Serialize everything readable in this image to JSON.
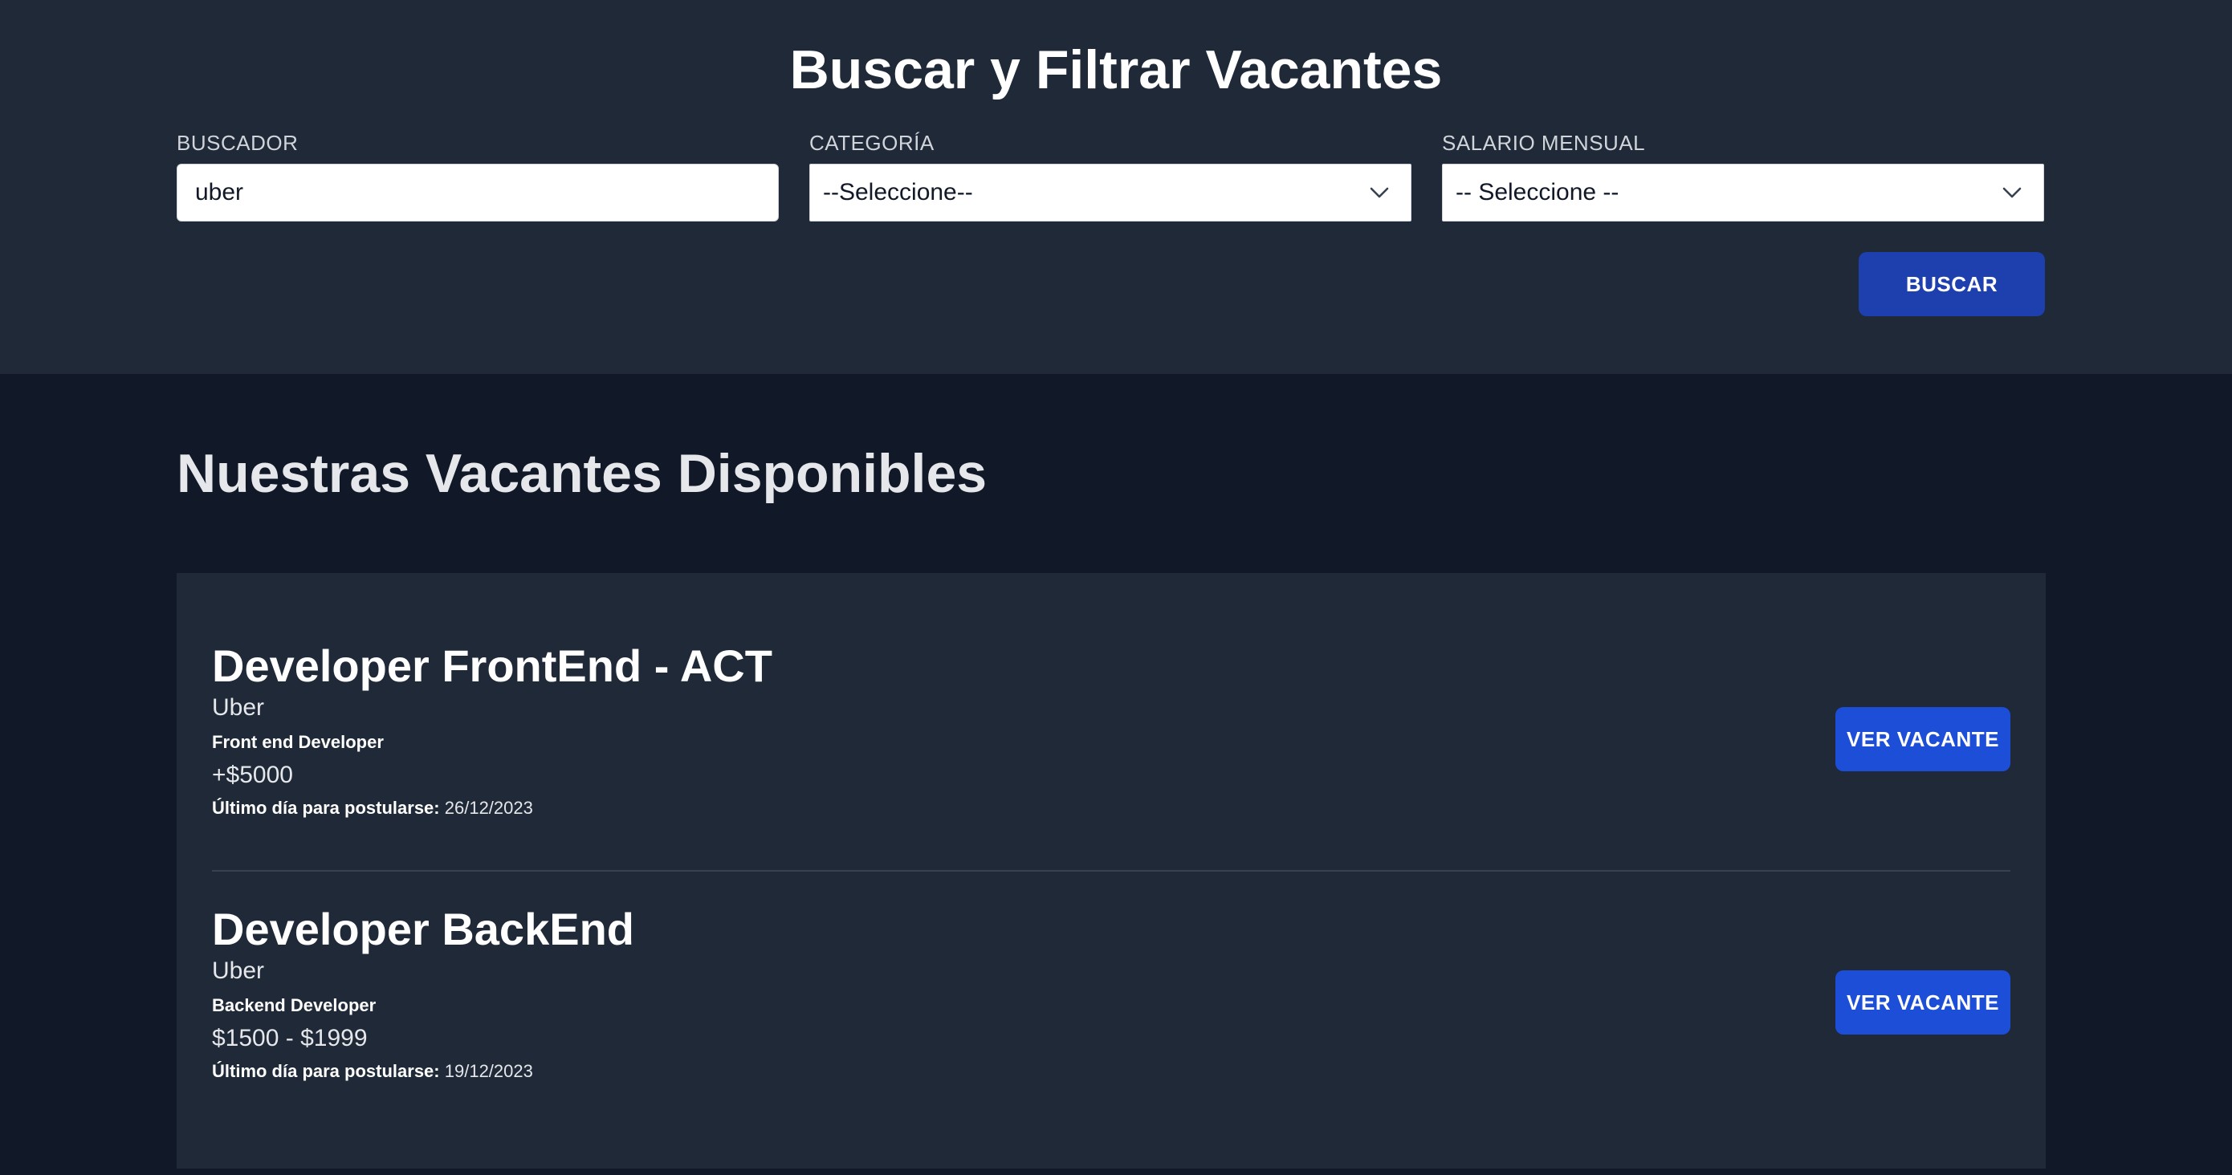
{
  "search": {
    "title": "Buscar y Filtrar Vacantes",
    "buscador_label": "BUSCADOR",
    "buscador_value": "uber",
    "categoria_label": "CATEGORÍA",
    "categoria_selected": "--Seleccione--",
    "salario_label": "SALARIO MENSUAL",
    "salario_selected": "-- Seleccione --",
    "button_label": "BUSCAR"
  },
  "listing": {
    "title": "Nuestras Vacantes Disponibles",
    "deadline_label": "Último día para postularse:",
    "view_button_label": "VER VACANTE",
    "jobs": [
      {
        "title": "Developer FrontEnd - ACT",
        "company": "Uber",
        "category": "Front end Developer",
        "salary": "+$5000",
        "deadline": "26/12/2023"
      },
      {
        "title": "Developer BackEnd",
        "company": "Uber",
        "category": "Backend Developer",
        "salary": "$1500 - $1999",
        "deadline": "19/12/2023"
      }
    ]
  },
  "colors": {
    "page_bg": "#111827",
    "panel_bg": "#1f2937",
    "button_bg": "#1e40af",
    "view_button_bg": "#1d4ed8"
  }
}
